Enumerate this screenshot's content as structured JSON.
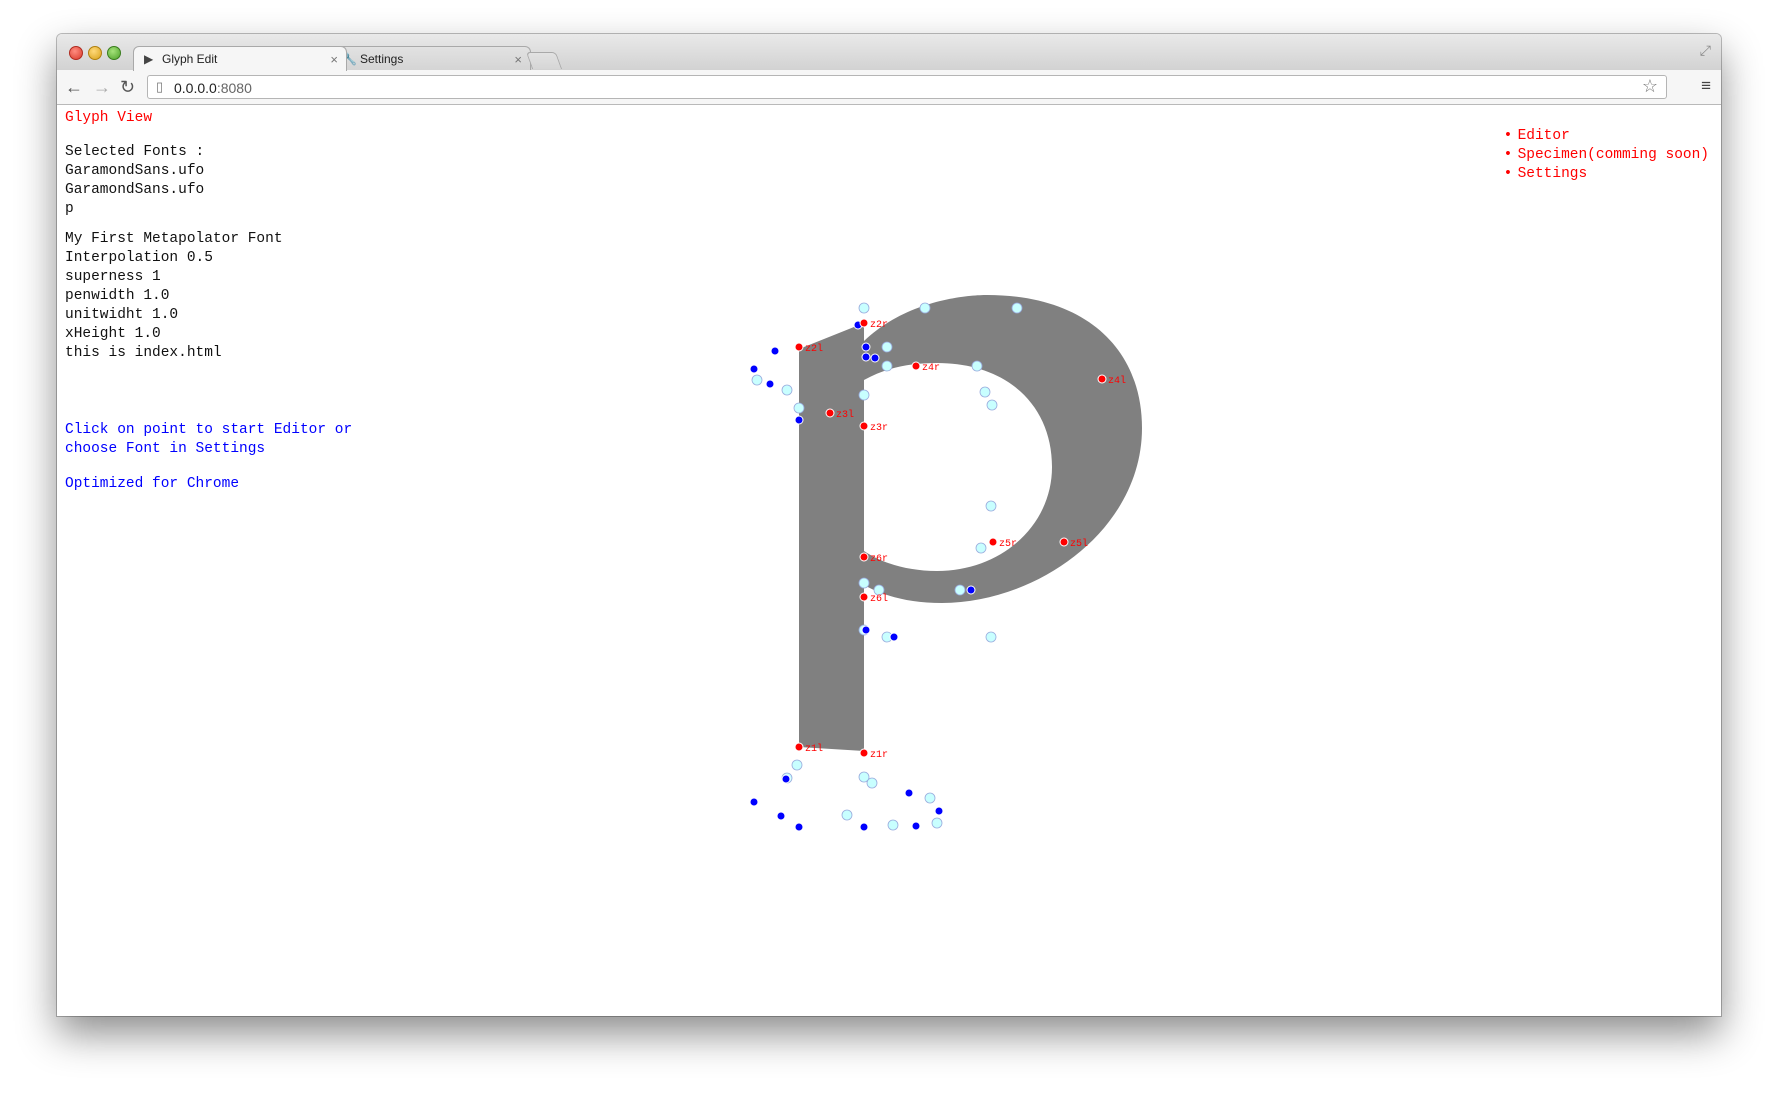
{
  "browser": {
    "tabs": [
      {
        "title": "Glyph Edit",
        "icon": "metapolator-icon",
        "active": true
      },
      {
        "title": "Settings",
        "icon": "wrench-icon",
        "active": false
      }
    ],
    "url_host": "0.0.0.0",
    "url_port": ":8080"
  },
  "page": {
    "heading": "Glyph View",
    "selected_fonts_label": "Selected Fonts :",
    "fonts": [
      "GaramondSans.ufo",
      "GaramondSans.ufo"
    ],
    "glyph": "p",
    "params": [
      "My First Metapolator Font",
      "Interpolation 0.5",
      "superness 1",
      "penwidth 1.0",
      "unitwidht 1.0",
      "xHeight 1.0",
      "this is index.html"
    ],
    "hint_line1": "Click on point to start Editor or",
    "hint_line2": "choose Font in Settings",
    "optimized": "Optimized for Chrome",
    "nav": [
      "Editor",
      "Specimen(comming soon)",
      "Settings"
    ]
  },
  "colors": {
    "glyph_fill": "#808080",
    "on_curve_point": "#ff0000",
    "control_point": "#0000ff",
    "handle_point": "#c8ffff",
    "link": "#ff0000",
    "hint": "#0000ff"
  },
  "glyph_points": {
    "labels": [
      "z2r",
      "z2l",
      "z4r",
      "z4l",
      "z3l",
      "z3r",
      "z5r",
      "z5l",
      "z6r",
      "z6l",
      "z1l",
      "z1r"
    ]
  }
}
